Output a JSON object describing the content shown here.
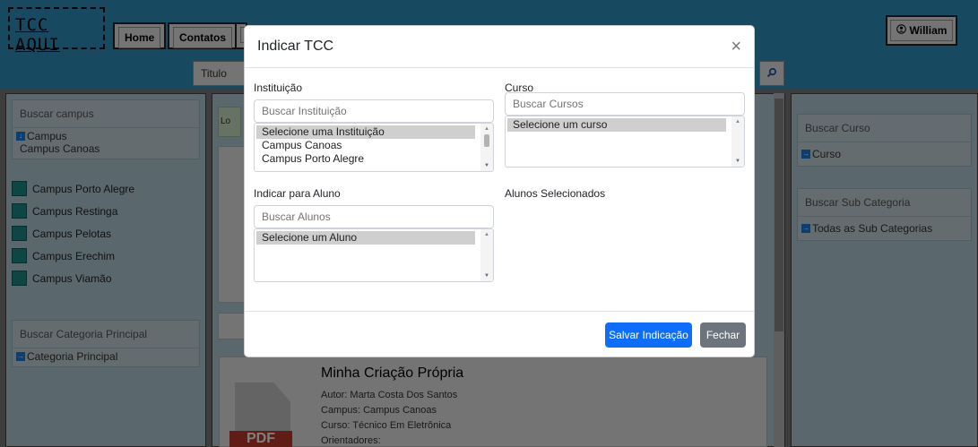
{
  "header": {
    "logo_text": "TCC AQUI",
    "nav": [
      "Home",
      "Contatos"
    ],
    "user_label": "William",
    "search_field_label": "Titulo"
  },
  "left_sidebar": {
    "campus_search_placeholder": "Buscar campus",
    "campus_root": "Campus",
    "campuses": [
      "Campus Canoas",
      "Campus Porto Alegre",
      "Campus Restinga",
      "Campus Pelotas",
      "Campus Erechim",
      "Campus Viamão"
    ],
    "category_search_placeholder": "Buscar Categoria Principal",
    "category_root": "Categoria Principal"
  },
  "right_sidebar": {
    "course_search_placeholder": "Buscar Curso",
    "course_root": "Curso",
    "subcategory_search_placeholder": "Buscar Sub Categoria",
    "subcategory_root": "Todas as Sub Categorias"
  },
  "main": {
    "loading_prefix": "Lo",
    "card": {
      "title": "Minha Criação Própria",
      "author": "Autor: Marta Costa Dos Santos",
      "campus": "Campus: Campus Canoas",
      "course": "Curso: Técnico Em Eletrônica",
      "advisors": "Orientadores:",
      "file_type": "PDF"
    }
  },
  "modal": {
    "title": "Indicar TCC",
    "institution": {
      "label": "Instituição",
      "placeholder": "Buscar Instituição",
      "options": [
        "Selecione uma Instituição",
        "Campus Canoas",
        "Campus Porto Alegre"
      ]
    },
    "course": {
      "label": "Curso",
      "placeholder": "Buscar Cursos",
      "options": [
        "Selecione um curso"
      ]
    },
    "student": {
      "label": "Indicar para Aluno",
      "placeholder": "Buscar Alunos",
      "options": [
        "Selecione um Aluno"
      ]
    },
    "selected_students_label": "Alunos Selecionados",
    "save_label": "Salvar Indicação",
    "close_label": "Fechar"
  },
  "colors": {
    "header_bg": "#2f93c2",
    "primary": "#0d6efd",
    "secondary": "#6c757d",
    "campus_square": "#1d8c8c"
  }
}
